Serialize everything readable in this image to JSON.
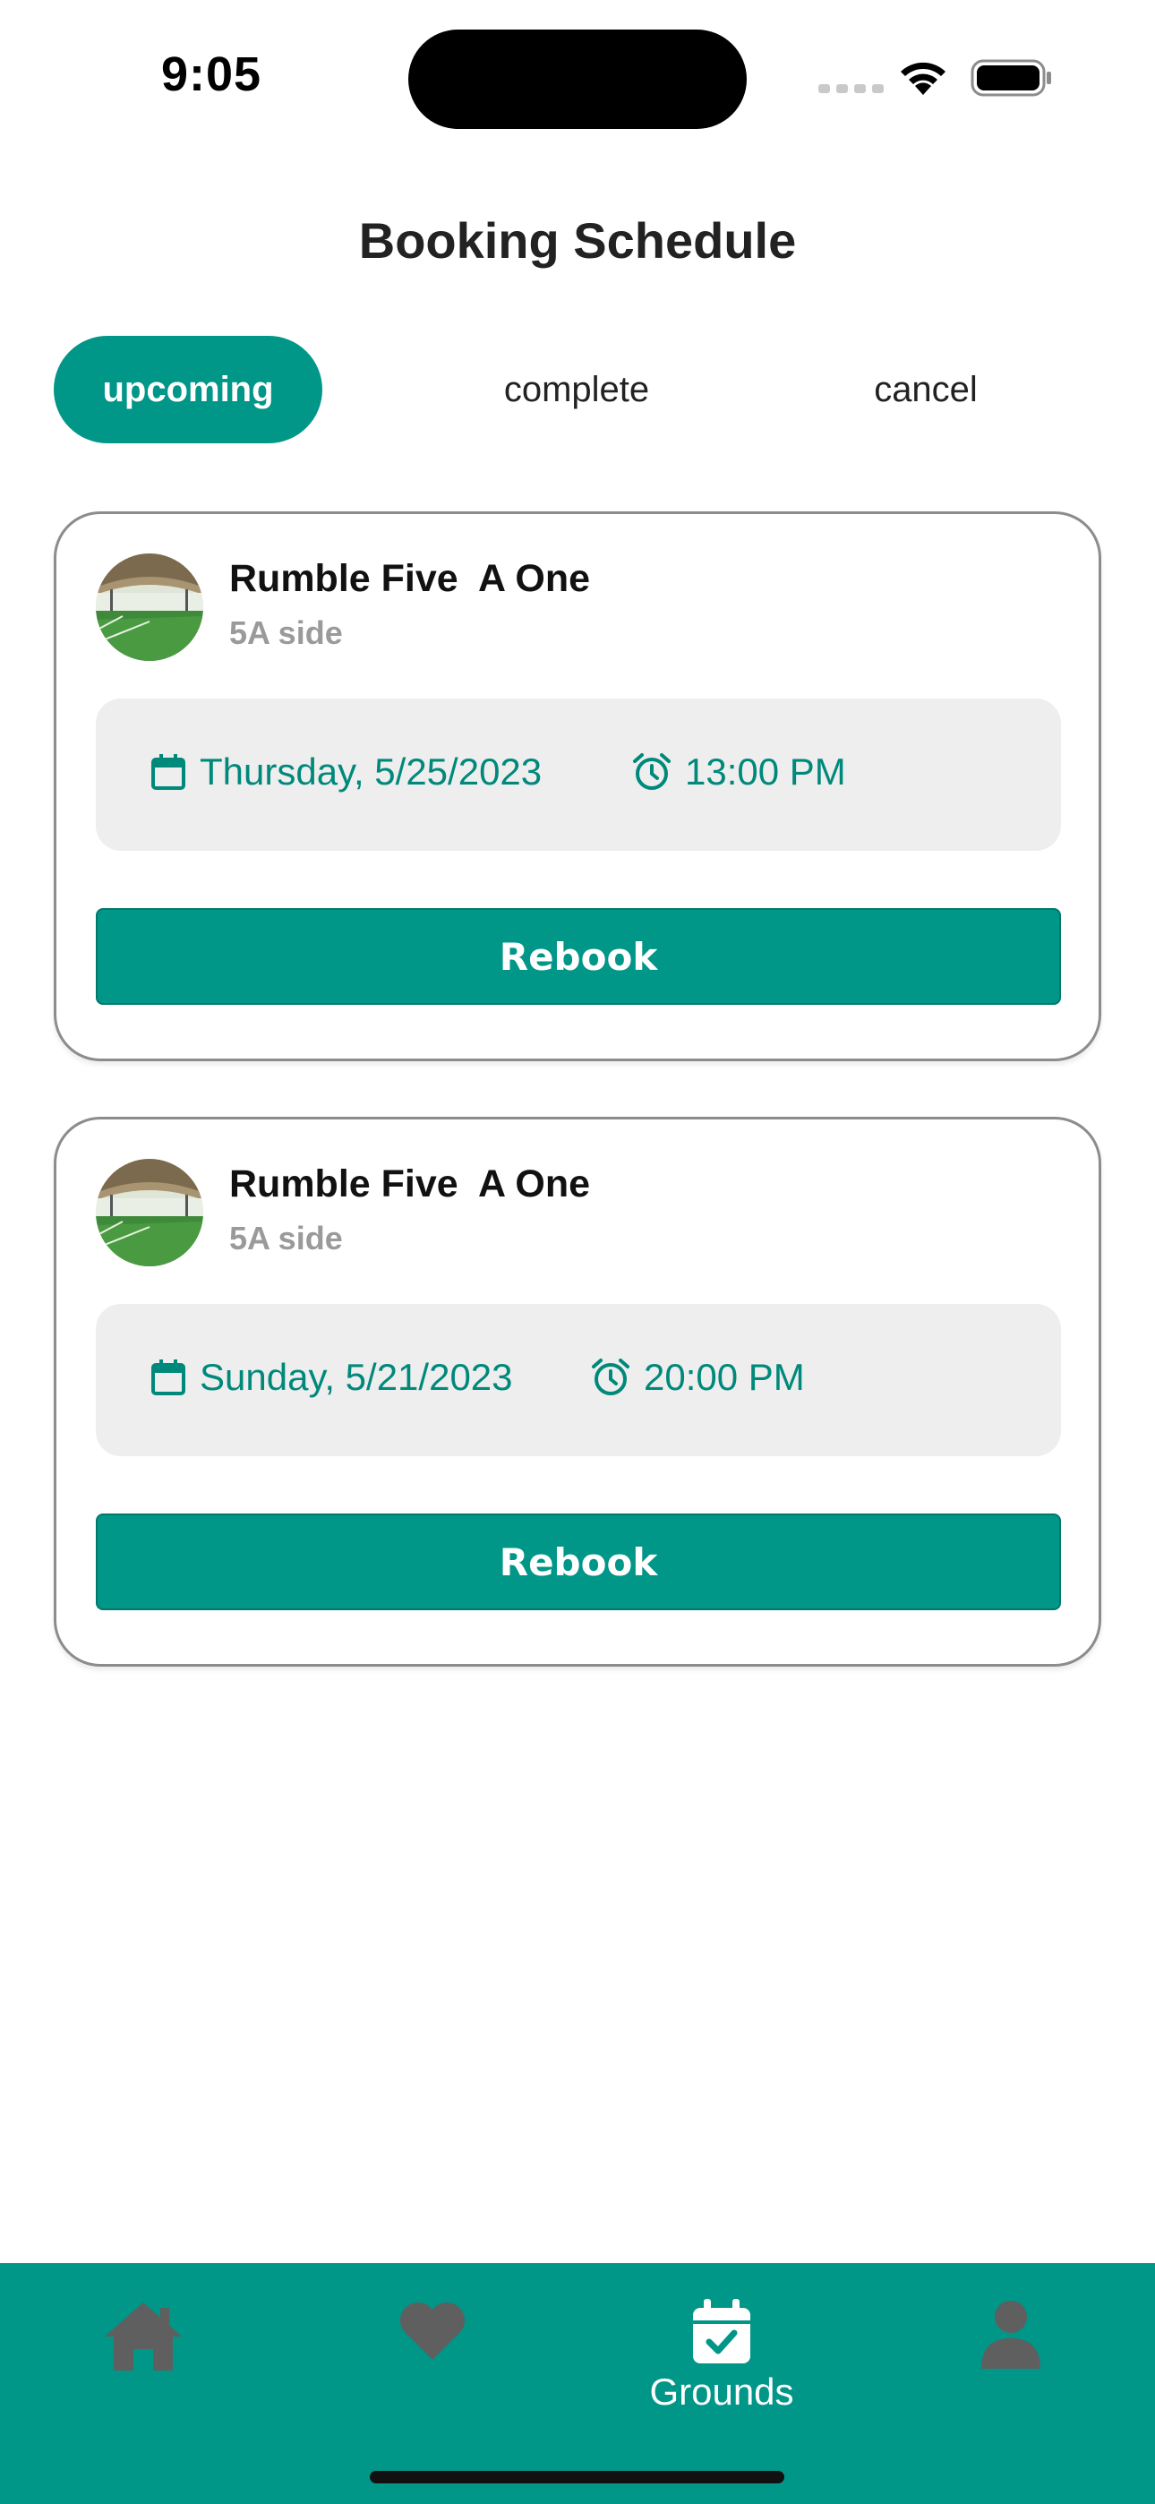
{
  "status_bar": {
    "time": "9:05"
  },
  "header": {
    "title": "Booking Schedule"
  },
  "tabs": [
    {
      "label": "upcoming",
      "active": true
    },
    {
      "label": "complete",
      "active": false
    },
    {
      "label": "cancel",
      "active": false
    }
  ],
  "bookings": [
    {
      "venue": "Rumble Five  A One",
      "type": "5A side",
      "date": "Thursday, 5/25/2023",
      "time": "13:00 PM",
      "action": "Rebook"
    },
    {
      "venue": "Rumble Five  A One",
      "type": "5A side",
      "date": "Sunday, 5/21/2023",
      "time": "20:00 PM",
      "action": "Rebook"
    }
  ],
  "bottom_nav": {
    "items": [
      {
        "icon": "home-icon",
        "label": "",
        "active": false
      },
      {
        "icon": "heart-icon",
        "label": "",
        "active": false
      },
      {
        "icon": "calendar-check-icon",
        "label": "Grounds",
        "active": true
      },
      {
        "icon": "person-icon",
        "label": "",
        "active": false
      }
    ]
  },
  "colors": {
    "accent": "#009688",
    "accent_text": "#00897b",
    "inactive_icon": "#5f5f5f",
    "info_bg": "#eeeeee"
  }
}
